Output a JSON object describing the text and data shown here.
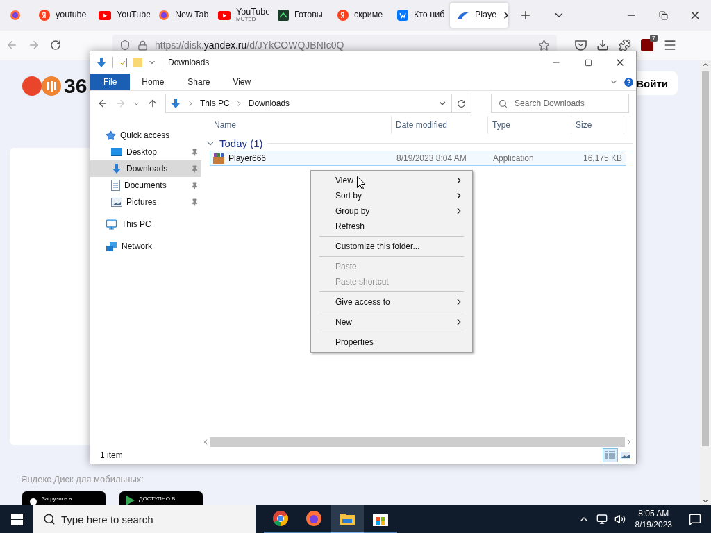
{
  "browser": {
    "tabs": [
      {
        "kind": "firefox",
        "selected": false
      },
      {
        "kind": "yandex",
        "label": "youtube",
        "selected": false
      },
      {
        "kind": "youtube",
        "label": "YouTube",
        "selected": false
      },
      {
        "kind": "firefox",
        "label": "New Tab",
        "selected": false
      },
      {
        "kind": "youtube",
        "label": "YouTube",
        "sublabel": "MUTED",
        "selected": false
      },
      {
        "kind": "game",
        "label": "Готовы",
        "selected": false
      },
      {
        "kind": "yandex",
        "label": "скриме",
        "selected": false
      },
      {
        "kind": "vk",
        "label": "Кто ниб",
        "selected": false
      },
      {
        "kind": "disk",
        "label": "Playe",
        "selected": true
      }
    ],
    "url_prefix": "https://disk.",
    "url_domain": "yandex.ru",
    "url_path": "/d/JYkCOWQJBNIc0Q",
    "extension_badge": "7"
  },
  "page": {
    "logo_text": "36",
    "login_button": "Войти",
    "mobile_label": "Яндекс Диск для мобильных:",
    "store_badges": [
      {
        "kind": "apple",
        "caption": "Загрузите в"
      },
      {
        "kind": "google",
        "caption": "ДОСТУПНО В"
      }
    ]
  },
  "explorer": {
    "title": "Downloads",
    "ribbon_tabs": [
      {
        "label": "File",
        "selected": true
      },
      {
        "label": "Home",
        "selected": false
      },
      {
        "label": "Share",
        "selected": false
      },
      {
        "label": "View",
        "selected": false
      }
    ],
    "breadcrumb": [
      "This PC",
      "Downloads"
    ],
    "search_placeholder": "Search Downloads",
    "nav": [
      {
        "kind": "star",
        "label": "Quick access",
        "selected": false,
        "children": [
          {
            "kind": "desktop",
            "label": "Desktop",
            "selected": false,
            "pinned": true
          },
          {
            "kind": "download",
            "label": "Downloads",
            "selected": true,
            "pinned": true
          },
          {
            "kind": "document",
            "label": "Documents",
            "selected": false,
            "pinned": true
          },
          {
            "kind": "picture",
            "label": "Pictures",
            "selected": false,
            "pinned": true
          }
        ]
      },
      {
        "kind": "pc",
        "label": "This PC",
        "selected": false
      },
      {
        "kind": "network",
        "label": "Network",
        "selected": false
      }
    ],
    "columns": [
      "Name",
      "Date modified",
      "Type",
      "Size"
    ],
    "groups": [
      {
        "label": "Today (1)",
        "expanded": true,
        "rows": [
          {
            "name": "Player666",
            "date": "8/19/2023 8:04 AM",
            "type": "Application",
            "size": "16,175 KB",
            "selected": true
          }
        ]
      }
    ],
    "status": "1 item",
    "views": [
      {
        "kind": "details",
        "selected": true
      },
      {
        "kind": "tiles",
        "selected": false
      }
    ]
  },
  "context_menu": [
    {
      "kind": "item",
      "label": "View",
      "submenu": true,
      "disabled": false
    },
    {
      "kind": "item",
      "label": "Sort by",
      "submenu": true,
      "disabled": false
    },
    {
      "kind": "item",
      "label": "Group by",
      "submenu": true,
      "disabled": false
    },
    {
      "kind": "item",
      "label": "Refresh",
      "submenu": false,
      "disabled": false
    },
    {
      "kind": "separator"
    },
    {
      "kind": "item",
      "label": "Customize this folder...",
      "submenu": false,
      "disabled": false
    },
    {
      "kind": "separator"
    },
    {
      "kind": "item",
      "label": "Paste",
      "submenu": false,
      "disabled": true
    },
    {
      "kind": "item",
      "label": "Paste shortcut",
      "submenu": false,
      "disabled": true
    },
    {
      "kind": "separator"
    },
    {
      "kind": "item",
      "label": "Give access to",
      "submenu": true,
      "disabled": false
    },
    {
      "kind": "separator"
    },
    {
      "kind": "item",
      "label": "New",
      "submenu": true,
      "disabled": false
    },
    {
      "kind": "separator"
    },
    {
      "kind": "item",
      "label": "Properties",
      "submenu": false,
      "disabled": false
    }
  ],
  "taskbar": {
    "search_placeholder": "Type here to search",
    "apps": [
      {
        "kind": "chrome",
        "active": false
      },
      {
        "kind": "firefox",
        "active": false
      },
      {
        "kind": "explorer",
        "active": true
      },
      {
        "kind": "store",
        "active": false
      }
    ],
    "time": "8:05 AM",
    "date": "8/19/2023"
  }
}
